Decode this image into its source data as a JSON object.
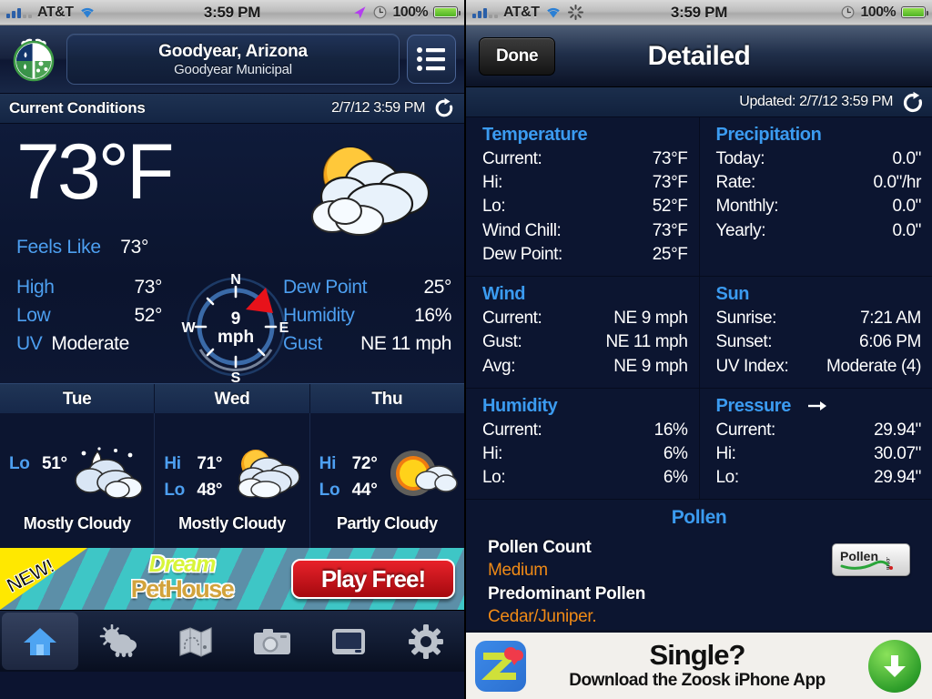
{
  "left": {
    "statusbar": {
      "carrier": "AT&T",
      "time": "3:59 PM",
      "battery_pct": "100%",
      "icons": [
        "signal-bars-icon",
        "wifi-icon",
        "location-arrow-icon",
        "alarm-clock-icon",
        "battery-icon"
      ]
    },
    "nav": {
      "logo": "weatherbug-ladybug-logo",
      "city": "Goodyear, Arizona",
      "station": "Goodyear Municipal",
      "list_button": "list-icon"
    },
    "conditions_bar": {
      "title": "Current Conditions",
      "timestamp": "2/7/12 3:59 PM",
      "refresh": "refresh-icon"
    },
    "current": {
      "temperature": "73°F",
      "icon": "partly-cloudy-day-icon",
      "feels_like_label": "Feels Like",
      "feels_like_value": "73°",
      "left_rows": [
        {
          "label": "High",
          "value": "73°"
        },
        {
          "label": "Low",
          "value": "52°"
        },
        {
          "label": "UV",
          "value": "Moderate"
        }
      ],
      "right_rows": [
        {
          "label": "Dew Point",
          "value": "25°"
        },
        {
          "label": "Humidity",
          "value": "16%"
        },
        {
          "label": "Gust",
          "value": "NE 11 mph"
        }
      ],
      "compass": {
        "n": "N",
        "e": "E",
        "s": "S",
        "w": "W",
        "speed": "9",
        "unit": "mph",
        "direction_deg": 45,
        "needle_color": "#e8121a"
      }
    },
    "forecast": [
      {
        "day": "Tue",
        "hi_label": "",
        "hi": "",
        "lo_label": "Lo",
        "lo": "51°",
        "desc": "Mostly Cloudy",
        "icon": "cloudy-night-icon"
      },
      {
        "day": "Wed",
        "hi_label": "Hi",
        "hi": "71°",
        "lo_label": "Lo",
        "lo": "48°",
        "desc": "Mostly Cloudy",
        "icon": "partly-cloudy-day-icon"
      },
      {
        "day": "Thu",
        "hi_label": "Hi",
        "hi": "72°",
        "lo_label": "Lo",
        "lo": "44°",
        "desc": "Partly Cloudy",
        "icon": "sunny-cloud-icon"
      }
    ],
    "ad": {
      "badge": "NEW!",
      "title_line1": "Dream",
      "title_line2": "PetHouse",
      "cta": "Play Free!"
    },
    "tabs": [
      {
        "name": "home",
        "icon": "home-icon",
        "active": true
      },
      {
        "name": "forecast",
        "icon": "sun-cloud-rain-icon",
        "active": false
      },
      {
        "name": "map",
        "icon": "map-icon",
        "active": false
      },
      {
        "name": "camera",
        "icon": "camera-icon",
        "active": false
      },
      {
        "name": "video",
        "icon": "screen-icon",
        "active": false
      },
      {
        "name": "settings",
        "icon": "gear-icon",
        "active": false
      }
    ]
  },
  "right": {
    "statusbar": {
      "carrier": "AT&T",
      "time": "3:59 PM",
      "battery_pct": "100%",
      "icons": [
        "signal-bars-icon",
        "wifi-icon",
        "activity-spinner-icon",
        "alarm-clock-icon",
        "battery-icon"
      ]
    },
    "nav": {
      "done_label": "Done",
      "title": "Detailed"
    },
    "updated": {
      "text": "Updated: 2/7/12 3:59 PM",
      "refresh": "refresh-icon"
    },
    "sections": [
      {
        "title": "Temperature",
        "rows": [
          {
            "k": "Current:",
            "v": "73°F"
          },
          {
            "k": "Hi:",
            "v": "73°F"
          },
          {
            "k": "Lo:",
            "v": "52°F"
          },
          {
            "k": "Wind Chill:",
            "v": "73°F"
          },
          {
            "k": "Dew Point:",
            "v": "25°F"
          }
        ]
      },
      {
        "title": "Precipitation",
        "rows": [
          {
            "k": "Today:",
            "v": "0.0\""
          },
          {
            "k": "Rate:",
            "v": "0.0\"/hr"
          },
          {
            "k": "Monthly:",
            "v": "0.0\""
          },
          {
            "k": "Yearly:",
            "v": "0.0\""
          }
        ]
      },
      {
        "title": "Wind",
        "rows": [
          {
            "k": "Current:",
            "v": "NE 9 mph"
          },
          {
            "k": "Gust:",
            "v": "NE 11 mph"
          },
          {
            "k": "Avg:",
            "v": "NE 9 mph"
          }
        ]
      },
      {
        "title": "Sun",
        "rows": [
          {
            "k": "Sunrise:",
            "v": "7:21 AM"
          },
          {
            "k": "Sunset:",
            "v": "6:06 PM"
          },
          {
            "k": "UV Index:",
            "v": "Moderate (4)"
          }
        ]
      },
      {
        "title": "Humidity",
        "rows": [
          {
            "k": "Current:",
            "v": "16%"
          },
          {
            "k": "Hi:",
            "v": "6%"
          },
          {
            "k": "Lo:",
            "v": "6%"
          }
        ]
      },
      {
        "title": "Pressure",
        "trend_icon": "arrow-right-icon",
        "rows": [
          {
            "k": "Current:",
            "v": "29.94\""
          },
          {
            "k": "Hi:",
            "v": "30.07\""
          },
          {
            "k": "Lo:",
            "v": "29.94\""
          }
        ]
      }
    ],
    "pollen": {
      "title": "Pollen",
      "count_label": "Pollen Count",
      "count_value": "Medium",
      "predominant_label": "Predominant Pollen",
      "predominant_value": "Cedar/Juniper.",
      "logo_text": "Pollen",
      "logo_suffix": ".com"
    },
    "ad": {
      "icon": "zoosk-z-icon",
      "headline": "Single?",
      "subline": "Download the Zoosk iPhone App",
      "download_icon": "download-arrow-icon"
    }
  },
  "colors": {
    "bg_navy": "#0c1530",
    "accent_blue": "#4d9ff0",
    "section_blue": "#3b9bf0",
    "pollen_orange": "#f08a16",
    "needle_red": "#e8121a"
  }
}
